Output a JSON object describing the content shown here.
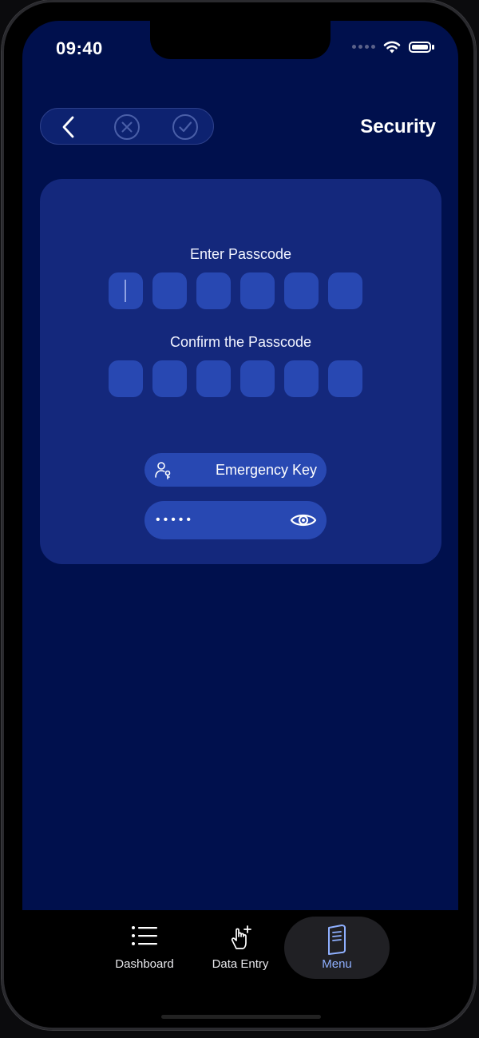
{
  "status_bar": {
    "time": "09:40"
  },
  "header": {
    "title": "Security"
  },
  "passcode": {
    "enter_label": "Enter Passcode",
    "confirm_label": "Confirm the Passcode"
  },
  "emergency": {
    "label": "Emergency Key",
    "masked_value": "•••••"
  },
  "tabs": [
    {
      "label": "Dashboard",
      "icon": "list-icon",
      "active": false
    },
    {
      "label": "Data Entry",
      "icon": "touch-add-icon",
      "active": false
    },
    {
      "label": "Menu",
      "icon": "book-icon",
      "active": true
    }
  ],
  "colors": {
    "background": "#00104d",
    "card": "#14287c",
    "input": "#2848b2",
    "active_tab": "#8fb0ff"
  }
}
